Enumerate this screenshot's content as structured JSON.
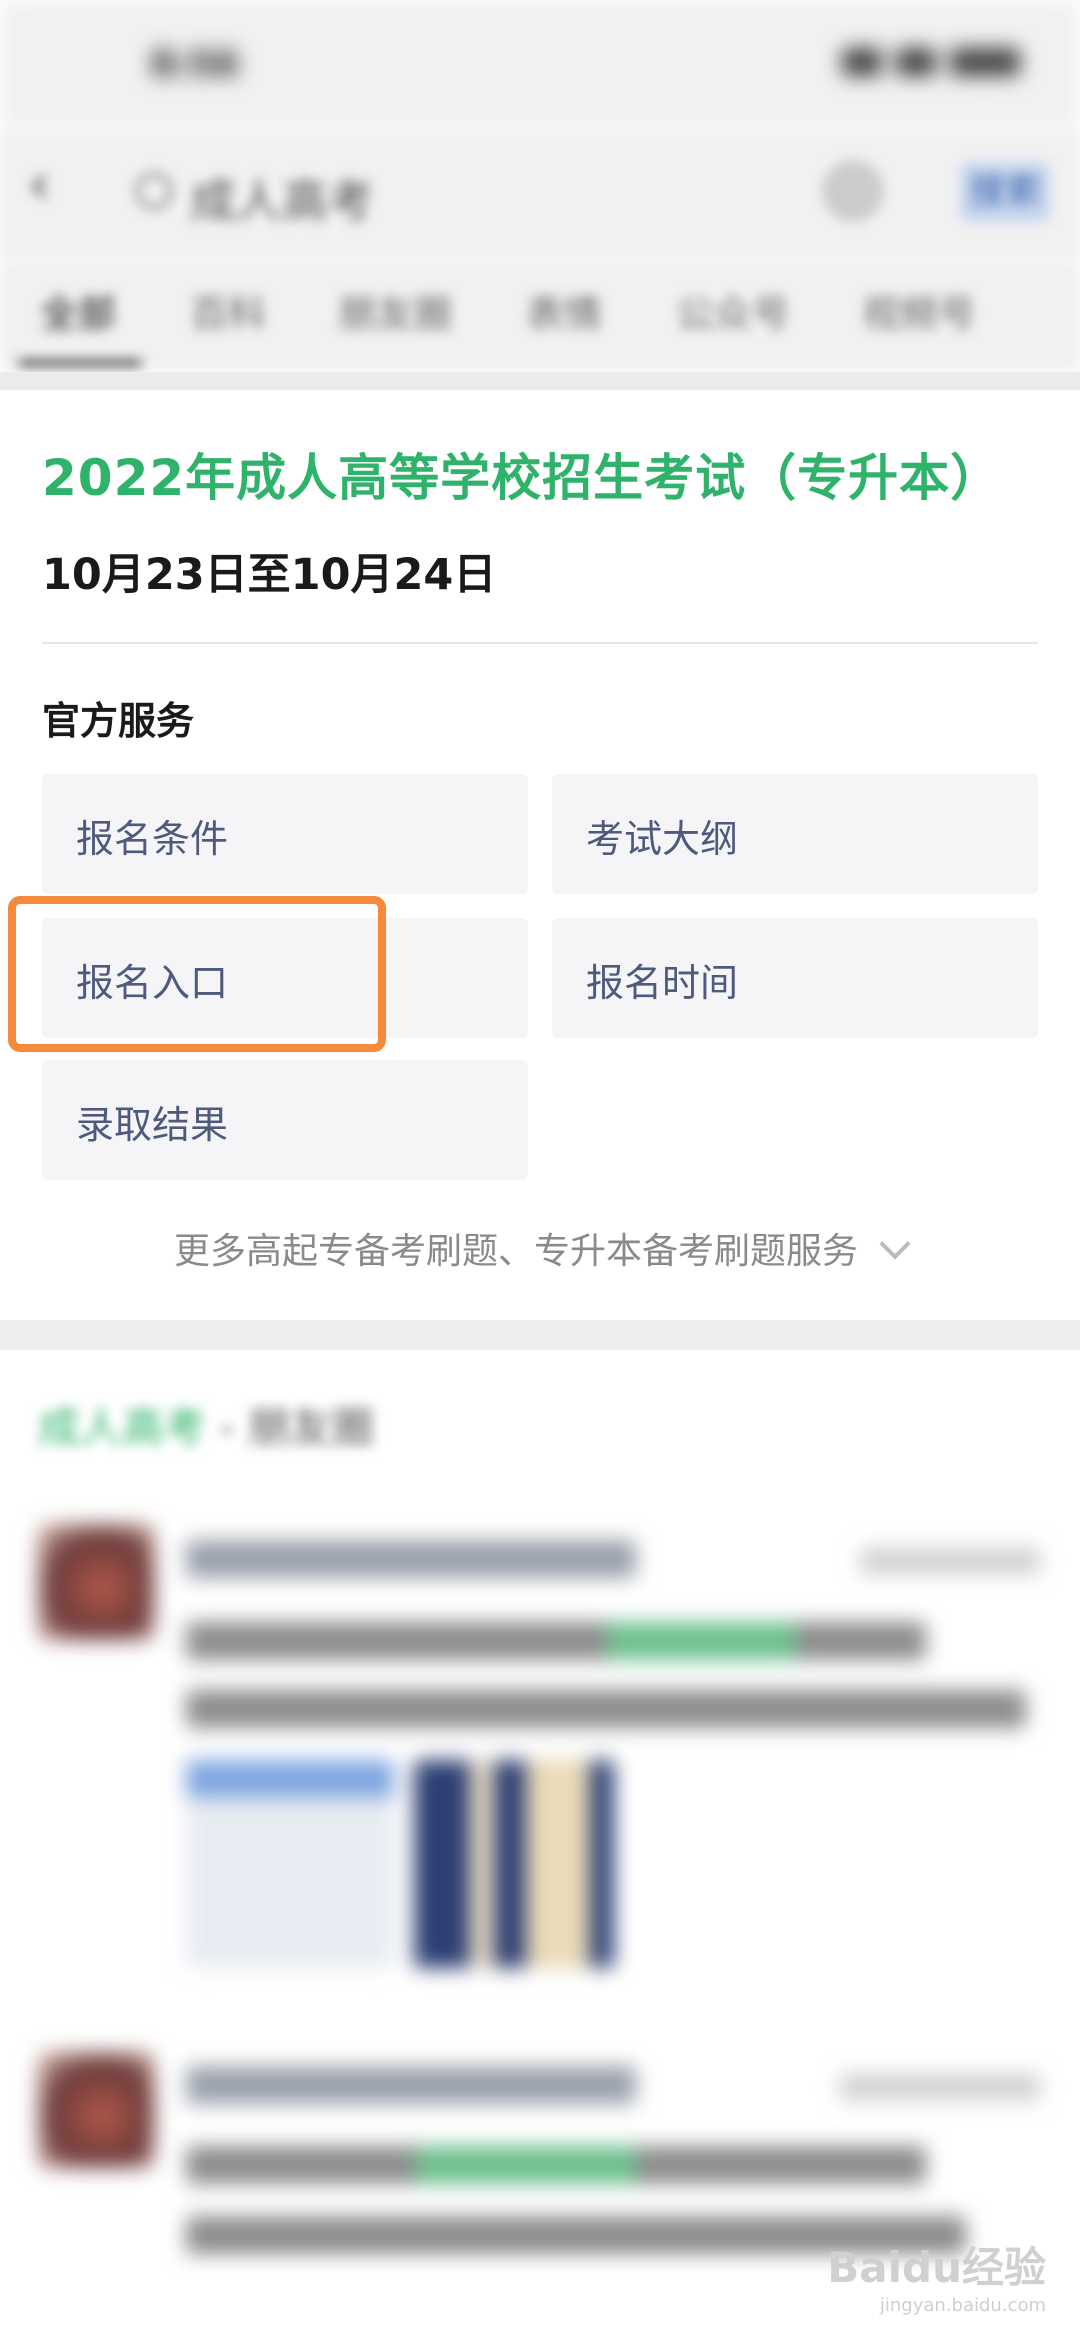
{
  "status_bar": {
    "time": "8:56"
  },
  "search": {
    "query": "成人高考",
    "button": "搜索"
  },
  "tabs": [
    "全部",
    "百科",
    "朋友圈",
    "表情",
    "公众号",
    "视频号"
  ],
  "card": {
    "title": "2022年成人高等学校招生考试（专升本）",
    "date": "10月23日至10月24日",
    "services_title": "官方服务",
    "services": [
      "报名条件",
      "考试大纲",
      "报名入口",
      "报名时间",
      "录取结果"
    ],
    "more": "更多高起专备考刷题、专升本备考刷题服务"
  },
  "moments": {
    "keyword": "成人高考",
    "suffix": " - 朋友圈"
  },
  "watermark": {
    "brand": "Baidu经验",
    "url": "jingyan.baidu.com"
  },
  "colors": {
    "accent_green": "#2fb36b",
    "service_text": "#4e5a7d",
    "highlight_orange": "#f58a3c"
  }
}
